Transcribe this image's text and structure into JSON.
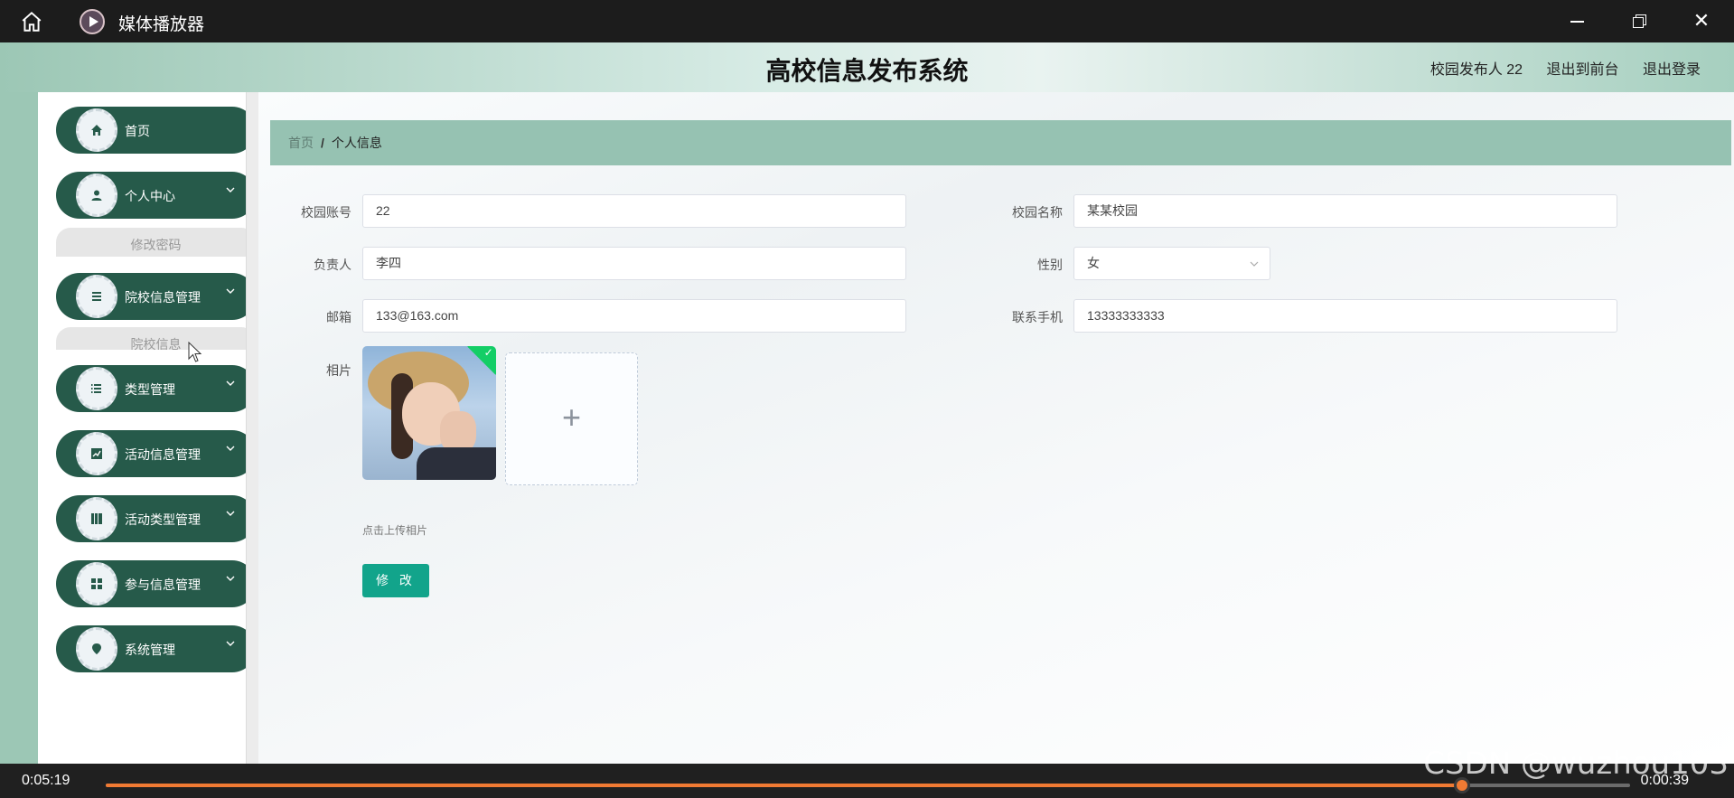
{
  "player": {
    "title": "媒体播放器",
    "close_glyph": "✕",
    "time_elapsed": "0:05:19",
    "time_remaining": "0:00:39",
    "progress": 0.89,
    "watermark": "CSDN @wuzhou103"
  },
  "header": {
    "title": "高校信息发布系统",
    "user_label": "校园发布人 22",
    "back_to_front": "退出到前台",
    "logout": "退出登录"
  },
  "sidebar": {
    "items": [
      {
        "label": "首页",
        "icon": "home-icon"
      },
      {
        "label": "个人中心",
        "icon": "user-icon",
        "sub": "修改密码"
      },
      {
        "label": "院校信息管理",
        "icon": "list-icon",
        "sub": "院校信息"
      },
      {
        "label": "类型管理",
        "icon": "list-icon"
      },
      {
        "label": "活动信息管理",
        "icon": "chart-icon"
      },
      {
        "label": "活动类型管理",
        "icon": "bookmark-icon"
      },
      {
        "label": "参与信息管理",
        "icon": "grid-icon"
      },
      {
        "label": "系统管理",
        "icon": "location-icon"
      }
    ]
  },
  "breadcrumb": {
    "home": "首页",
    "separator": "/",
    "current": "个人信息"
  },
  "form": {
    "account_label": "校园账号",
    "account_value": "22",
    "campus_label": "校园名称",
    "campus_value": "某某校园",
    "manager_label": "负责人",
    "manager_value": "李四",
    "gender_label": "性别",
    "gender_value": "女",
    "email_label": "邮箱",
    "email_value": "133@163.com",
    "phone_label": "联系手机",
    "phone_value": "13333333333",
    "photo_label": "相片",
    "upload_plus": "+",
    "upload_hint": "点击上传相片",
    "submit": "修 改"
  },
  "colors": {
    "menu_bg": "#265a4a",
    "accent": "#12a48b",
    "breadcrumb_bg": "#96c2b2",
    "progress": "#f07a33"
  }
}
